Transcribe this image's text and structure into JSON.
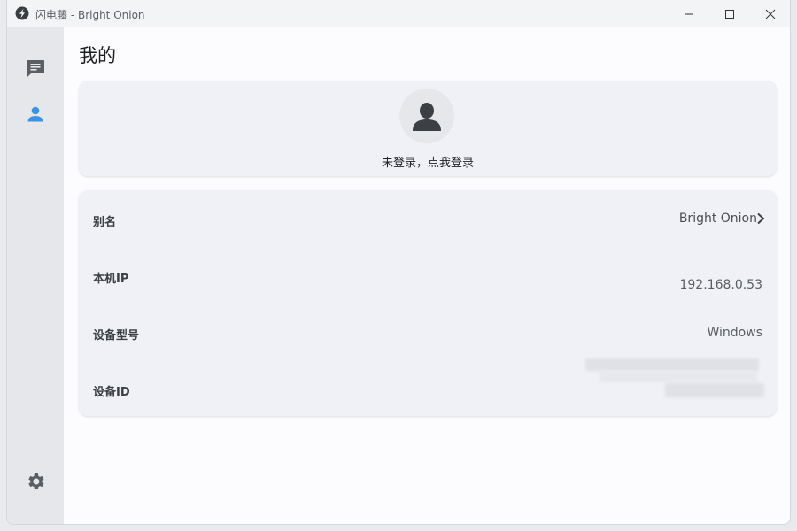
{
  "window": {
    "title": "闪电藤 - Bright Onion",
    "controls": [
      "minimize",
      "maximize",
      "close"
    ]
  },
  "sidebar": {
    "items": [
      {
        "name": "messages",
        "icon": "chat-icon",
        "active": false
      },
      {
        "name": "profile",
        "icon": "person-icon",
        "active": true
      }
    ],
    "settings_icon": "gear-icon"
  },
  "page": {
    "title": "我的"
  },
  "profile": {
    "login_prompt": "未登录，点我登录"
  },
  "info": {
    "alias_label": "别名",
    "alias_value": "Bright Onion",
    "ip_label": "本机IP",
    "ip_value": "192.168.0.53",
    "model_label": "设备型号",
    "model_value": "Windows",
    "device_id_label": "设备ID",
    "device_id_value": ""
  },
  "colors": {
    "accent": "#2f8fe0",
    "sidebar_bg": "#e6e7ea",
    "card_bg": "#eff1f6"
  }
}
